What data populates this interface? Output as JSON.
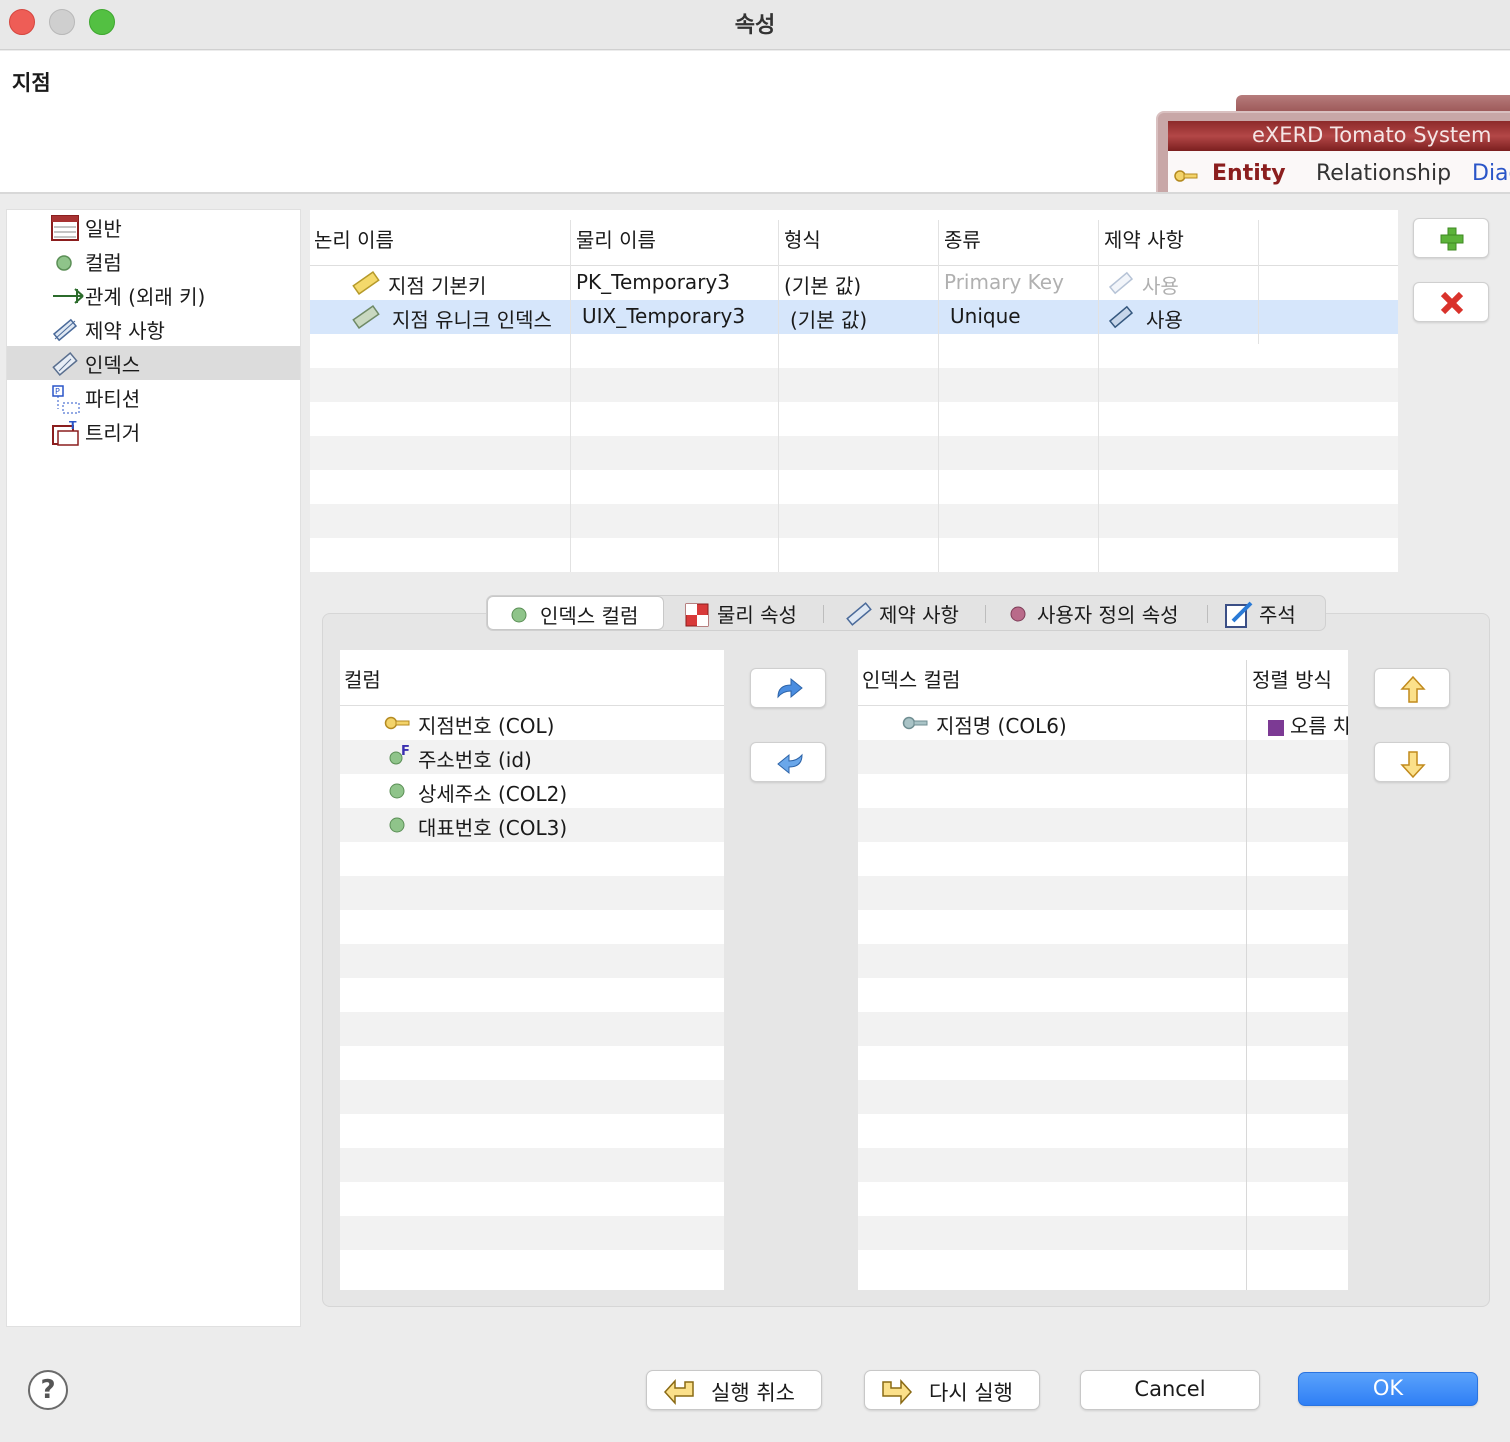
{
  "window": {
    "title": "속성"
  },
  "entity": {
    "name": "지점"
  },
  "banner": {
    "brand": "eXERD  Tomato System",
    "tabs": [
      "Entity",
      "Relationship",
      "Diag"
    ]
  },
  "tree": {
    "items": [
      {
        "label": "일반",
        "icon": "table-icon"
      },
      {
        "label": "컬럼",
        "icon": "column-dot-icon"
      },
      {
        "label": "관계 (외래 키)",
        "icon": "relationship-icon"
      },
      {
        "label": "제약 사항",
        "icon": "constraint-icon"
      },
      {
        "label": "인덱스",
        "icon": "index-icon",
        "selected": true
      },
      {
        "label": "파티션",
        "icon": "partition-icon"
      },
      {
        "label": "트리거",
        "icon": "trigger-icon"
      }
    ]
  },
  "index_table": {
    "headers": [
      "논리 이름",
      "물리 이름",
      "형식",
      "종류",
      "제약 사항"
    ],
    "rows": [
      {
        "logical": "지점 기본키",
        "physical": "PK_Temporary3",
        "format": "(기본 값)",
        "kind": "Primary Key",
        "constraint": "사용"
      },
      {
        "logical": "지점 유니크 인덱스",
        "physical": "UIX_Temporary3",
        "format": "(기본 값)",
        "kind": "Unique",
        "constraint": "사용"
      }
    ]
  },
  "tabs": [
    "인덱스 컬럼",
    "물리 속성",
    "제약 사항",
    "사용자 정의 속성",
    "주석"
  ],
  "columns_list": {
    "header": "컬럼",
    "items": [
      {
        "label": "지점번호 (COL)",
        "icon": "key-icon"
      },
      {
        "label": "주소번호 (id)",
        "icon": "foreign-key-icon"
      },
      {
        "label": "상세주소 (COL2)",
        "icon": "column-dot-icon"
      },
      {
        "label": "대표번호 (COL3)",
        "icon": "column-dot-icon"
      }
    ]
  },
  "index_columns": {
    "headers": [
      "인덱스 컬럼",
      "정렬 방식"
    ],
    "items": [
      {
        "label": "지점명 (COL6)",
        "sort": "오름 차"
      }
    ]
  },
  "buttons": {
    "undo": "실행 취소",
    "redo": "다시 실행",
    "cancel": "Cancel",
    "ok": "OK",
    "help": "?"
  },
  "colors": {
    "accent": "#2f7ff5",
    "selection": "#d6e6fb",
    "banner": "#8d2a2a"
  }
}
